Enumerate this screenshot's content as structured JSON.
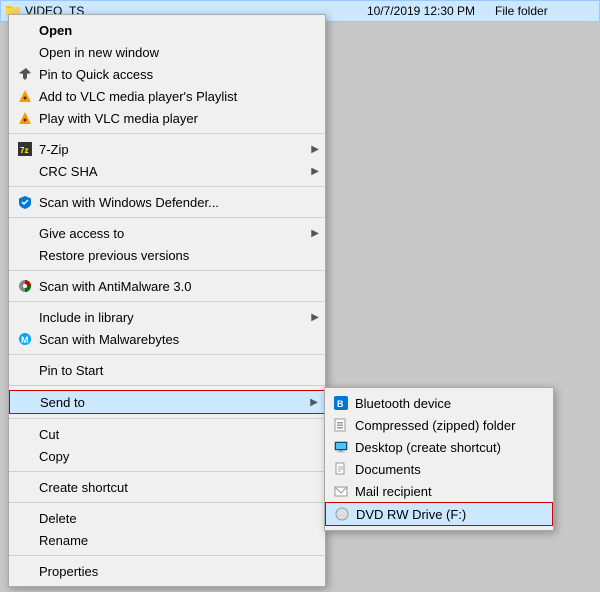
{
  "fileRow": {
    "name": "VIDEO_TS",
    "date": "10/7/2019 12:30 PM",
    "type": "File folder"
  },
  "contextMenu": {
    "items": [
      {
        "id": "open",
        "label": "Open",
        "icon": "none",
        "bold": true,
        "hasArrow": false
      },
      {
        "id": "open-new-window",
        "label": "Open in new window",
        "icon": "none",
        "bold": false,
        "hasArrow": false
      },
      {
        "id": "pin-quick-access",
        "label": "Pin to Quick access",
        "icon": "pin",
        "bold": false,
        "hasArrow": false
      },
      {
        "id": "add-vlc-playlist",
        "label": "Add to VLC media player's Playlist",
        "icon": "vlc",
        "bold": false,
        "hasArrow": false
      },
      {
        "id": "play-vlc",
        "label": "Play with VLC media player",
        "icon": "vlc",
        "bold": false,
        "hasArrow": false
      },
      {
        "id": "7zip",
        "label": "7-Zip",
        "icon": "7zip",
        "bold": false,
        "hasArrow": true
      },
      {
        "id": "crc-sha",
        "label": "CRC SHA",
        "icon": "none",
        "bold": false,
        "hasArrow": true
      },
      {
        "id": "scan-defender",
        "label": "Scan with Windows Defender...",
        "icon": "shield",
        "bold": false,
        "hasArrow": false
      },
      {
        "id": "give-access",
        "label": "Give access to",
        "icon": "none",
        "bold": false,
        "hasArrow": true
      },
      {
        "id": "restore-versions",
        "label": "Restore previous versions",
        "icon": "none",
        "bold": false,
        "hasArrow": false
      },
      {
        "id": "scan-antimalware",
        "label": "Scan with AntiMalware 3.0",
        "icon": "antimalware",
        "bold": false,
        "hasArrow": false
      },
      {
        "id": "include-library",
        "label": "Include in library",
        "icon": "none",
        "bold": false,
        "hasArrow": true
      },
      {
        "id": "scan-malwarebytes",
        "label": "Scan with Malwarebytes",
        "icon": "malwarebytes",
        "bold": false,
        "hasArrow": false
      },
      {
        "id": "pin-start",
        "label": "Pin to Start",
        "icon": "none",
        "bold": false,
        "hasArrow": false
      },
      {
        "id": "send-to",
        "label": "Send to",
        "icon": "none",
        "bold": false,
        "hasArrow": true,
        "highlighted": true
      },
      {
        "id": "cut",
        "label": "Cut",
        "icon": "none",
        "bold": false,
        "hasArrow": false
      },
      {
        "id": "copy",
        "label": "Copy",
        "icon": "none",
        "bold": false,
        "hasArrow": false
      },
      {
        "id": "create-shortcut",
        "label": "Create shortcut",
        "icon": "none",
        "bold": false,
        "hasArrow": false
      },
      {
        "id": "delete",
        "label": "Delete",
        "icon": "none",
        "bold": false,
        "hasArrow": false
      },
      {
        "id": "rename",
        "label": "Rename",
        "icon": "none",
        "bold": false,
        "hasArrow": false
      },
      {
        "id": "properties",
        "label": "Properties",
        "icon": "none",
        "bold": false,
        "hasArrow": false
      }
    ],
    "separatorsBefore": [
      "open",
      "7zip",
      "scan-defender",
      "give-access",
      "scan-antimalware",
      "include-library",
      "pin-start",
      "send-to",
      "cut",
      "create-shortcut",
      "delete",
      "properties"
    ]
  },
  "sendToSubmenu": {
    "items": [
      {
        "id": "bluetooth",
        "label": "Bluetooth device",
        "icon": "bluetooth",
        "highlighted": false
      },
      {
        "id": "compressed",
        "label": "Compressed (zipped) folder",
        "icon": "zip",
        "highlighted": false
      },
      {
        "id": "desktop",
        "label": "Desktop (create shortcut)",
        "icon": "desktop",
        "highlighted": false
      },
      {
        "id": "documents",
        "label": "Documents",
        "icon": "documents",
        "highlighted": false
      },
      {
        "id": "mail",
        "label": "Mail recipient",
        "icon": "mail",
        "highlighted": false
      },
      {
        "id": "dvd",
        "label": "DVD RW Drive (F:)",
        "icon": "dvd",
        "highlighted": true
      }
    ]
  },
  "icons": {
    "arrow": "▶",
    "folder": "📁"
  }
}
